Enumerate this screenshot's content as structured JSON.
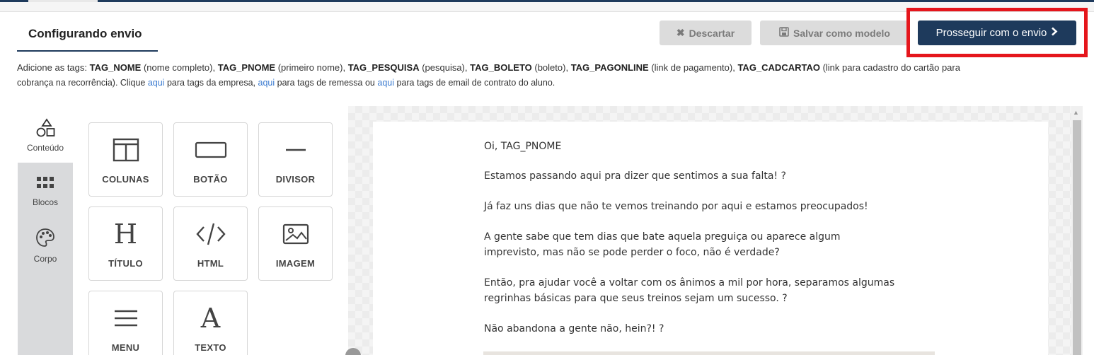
{
  "header": {
    "title": "Configurando envio",
    "discard_label": "Descartar",
    "save_template_label": "Salvar como modelo",
    "proceed_label": "Prosseguir com o envio"
  },
  "tags_info": {
    "line1": [
      {
        "t": "Adicione as tags: ",
        "b": false
      },
      {
        "t": "TAG_NOME",
        "b": true
      },
      {
        "t": " (nome completo), ",
        "b": false
      },
      {
        "t": "TAG_PNOME",
        "b": true
      },
      {
        "t": " (primeiro nome), ",
        "b": false
      },
      {
        "t": "TAG_PESQUISA",
        "b": true
      },
      {
        "t": " (pesquisa), ",
        "b": false
      },
      {
        "t": "TAG_BOLETO",
        "b": true
      },
      {
        "t": " (boleto), ",
        "b": false
      },
      {
        "t": "TAG_PAGONLINE",
        "b": true
      },
      {
        "t": " (link de pagamento), ",
        "b": false
      },
      {
        "t": "TAG_CADCARTAO",
        "b": true
      },
      {
        "t": " (link para cadastro do cartão para",
        "b": false
      }
    ],
    "line2": [
      {
        "t": "cobrança na recorrência). Clique ",
        "l": false
      },
      {
        "t": "aqui",
        "l": true
      },
      {
        "t": " para tags da empresa, ",
        "l": false
      },
      {
        "t": "aqui",
        "l": true
      },
      {
        "t": " para tags de remessa ou ",
        "l": false
      },
      {
        "t": "aqui",
        "l": true
      },
      {
        "t": " para tags de email de contrato do aluno.",
        "l": false
      }
    ]
  },
  "left_nav": {
    "content": "Conteúdo",
    "blocks": "Blocos",
    "body": "Corpo"
  },
  "tools": {
    "columns": "COLUNAS",
    "button": "BOTÃO",
    "divider": "DIVISOR",
    "title": "TÍTULO",
    "html": "HTML",
    "image": "IMAGEM",
    "menu": "MENU",
    "text": "TEXTO"
  },
  "email": {
    "p1": "Oi, TAG_PNOME",
    "p2": "Estamos passando aqui pra dizer que sentimos a sua falta! ?",
    "p3": "Já faz uns dias que não te vemos treinando por aqui e estamos preocupados!",
    "p4a": "A gente sabe que tem dias que bate aquela preguiça ou aparece algum",
    "p4b": "imprevisto, mas não se pode perder o foco, não é verdade?",
    "p5a": "Então, pra ajudar você a voltar com os ânimos a mil por hora, separamos algumas",
    "p5b": "regrinhas básicas para que seus treinos sejam um sucesso. ?",
    "p6": "Não abandona a gente não, hein?! ?"
  },
  "colors": {
    "primary": "#1e3a5c",
    "highlight": "#e5161c",
    "link": "#3b7bd0"
  }
}
